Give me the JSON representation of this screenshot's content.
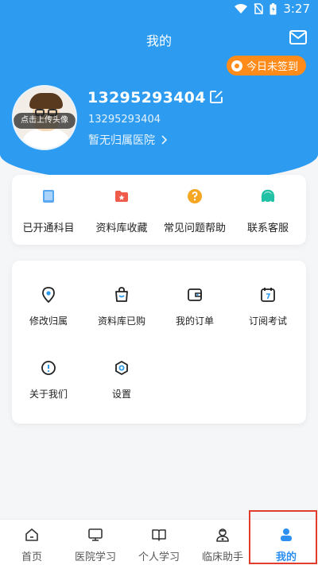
{
  "status_bar": {
    "time": "3:27",
    "icons": [
      "wifi-icon",
      "no-sim-icon",
      "battery-charging-icon"
    ]
  },
  "header": {
    "title": "我的",
    "mail_icon": "mail-icon",
    "signin_label": "今日未签到"
  },
  "profile": {
    "avatar_overlay": "点击上传头像",
    "phone": "13295293404",
    "phone_secondary": "13295293404",
    "hospital": "暂无归属医院"
  },
  "quick_actions": [
    {
      "label": "已开通科目",
      "icon": "book-icon",
      "color": "#5aa7f2"
    },
    {
      "label": "资料库收藏",
      "icon": "folder-star-icon",
      "color": "#f05a4a"
    },
    {
      "label": "常见问题帮助",
      "icon": "question-icon",
      "color": "#f5a623"
    },
    {
      "label": "联系客服",
      "icon": "headset-icon",
      "color": "#21c1a6"
    }
  ],
  "grid_items": [
    {
      "label": "修改归属",
      "icon": "location-pin-icon"
    },
    {
      "label": "资料库已购",
      "icon": "shopping-bag-icon"
    },
    {
      "label": "我的订单",
      "icon": "wallet-icon"
    },
    {
      "label": "订阅考试",
      "icon": "calendar-icon"
    },
    {
      "label": "关于我们",
      "icon": "info-icon"
    },
    {
      "label": "设置",
      "icon": "settings-icon"
    }
  ],
  "tabs": [
    {
      "label": "首页",
      "icon": "home-icon"
    },
    {
      "label": "医院学习",
      "icon": "monitor-icon"
    },
    {
      "label": "个人学习",
      "icon": "open-book-icon"
    },
    {
      "label": "临床助手",
      "icon": "doctor-icon"
    },
    {
      "label": "我的",
      "icon": "person-icon",
      "active": true
    }
  ],
  "colors": {
    "primary": "#2d9cf0",
    "signin": "#ff8b1a",
    "active_tab": "#2d8ff0",
    "highlight": "#e33b2e"
  }
}
